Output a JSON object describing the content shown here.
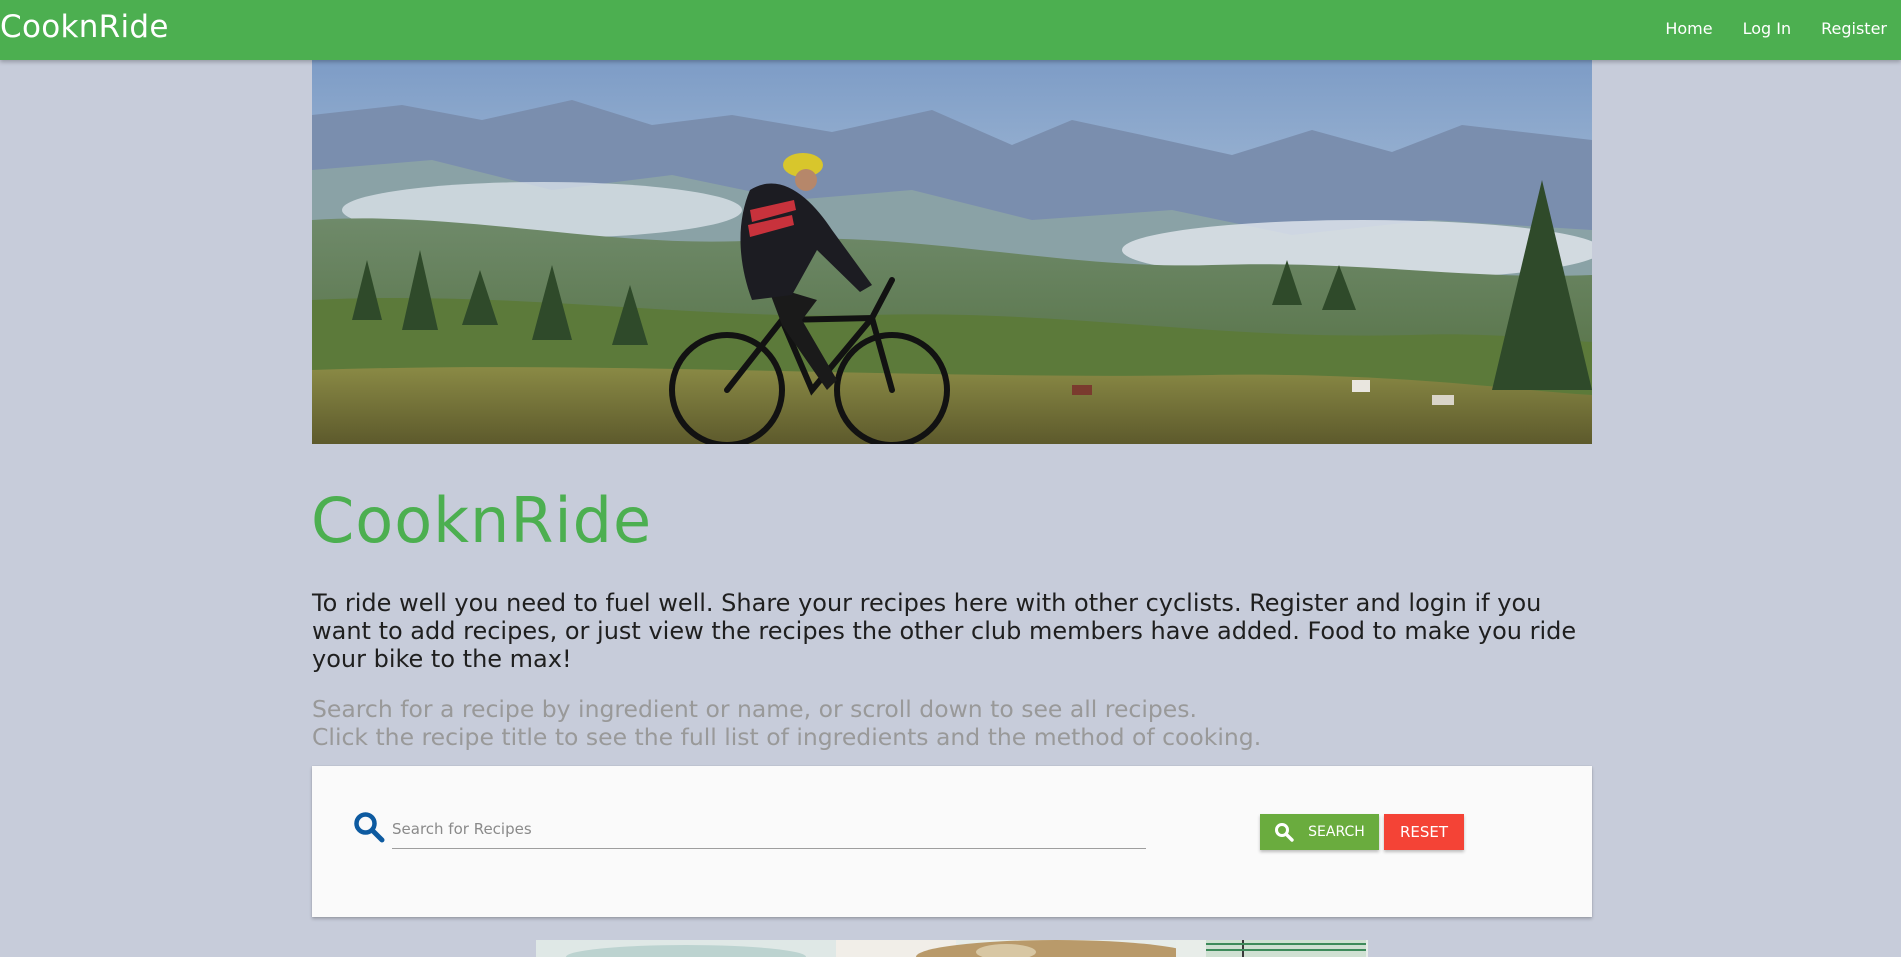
{
  "navbar": {
    "brand": "CooknRide",
    "links": [
      "Home",
      "Log In",
      "Register"
    ]
  },
  "hero": {
    "image": "cyclist-mountain-landscape"
  },
  "main": {
    "title": "CooknRide",
    "intro": "To ride well you need to fuel well. Share your recipes here with other cyclists. Register and login if you want to add recipes, or just view the recipes the other club members have added. Food to make you ride your bike to the max!",
    "hint_line1": "Search for a recipe by ingredient or name, or scroll down to see all recipes.",
    "hint_line2": "Click the recipe title to see the full list of ingredients and the method of cooking."
  },
  "search": {
    "placeholder": "Search for Recipes",
    "value": "",
    "icon": "search-icon",
    "search_label": "SEARCH",
    "reset_label": "RESET"
  },
  "colors": {
    "brand_green": "#4caf50",
    "page_bg": "#c7ccda",
    "search_button": "#6aac3e",
    "reset_button": "#f44336",
    "icon_blue": "#0d5aa0"
  }
}
